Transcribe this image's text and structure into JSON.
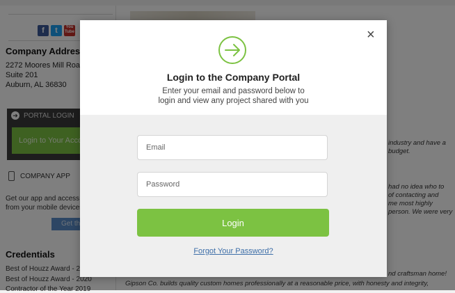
{
  "background": {
    "left": {
      "company_address_title": "Company Address",
      "address_lines": [
        "2272 Moores Mill Road",
        "Suite 201",
        "Auburn, AL 36830"
      ],
      "portal_login_label": "PORTAL LOGIN",
      "login_account_button": "Login to Your Account",
      "company_app_label": "COMPANY APP",
      "app_text_lines": [
        "Get our app and access your",
        "from your mobile devices"
      ],
      "get_button": "Get the",
      "credentials_title": "Credentials",
      "credentials": [
        "Best of Houzz Award - 2021",
        "Best of Houzz Award - 2020",
        "Contractor of the Year 2019"
      ]
    },
    "right": {
      "quote1": [
        "industry and have a",
        "budget."
      ],
      "quote2": [
        "had no idea who to",
        "of contacting and",
        "me most highly",
        "person. We were very"
      ],
      "quote3": [
        "nd craftsman home!",
        "Gipson Co. builds quality custom homes professionally at a reasonable price, with honesty and integrity,"
      ]
    }
  },
  "modal": {
    "close_label": "×",
    "title": "Login to the Company Portal",
    "subtitle_lines": [
      "Enter your email and password below to",
      "login and view any project shared with you"
    ],
    "email_placeholder": "Email",
    "password_placeholder": "Password",
    "login_button": "Login",
    "forgot_link": "Forgot Your Password?",
    "accent_color": "#7cc242",
    "icon": "circle-arrow-right-icon"
  }
}
